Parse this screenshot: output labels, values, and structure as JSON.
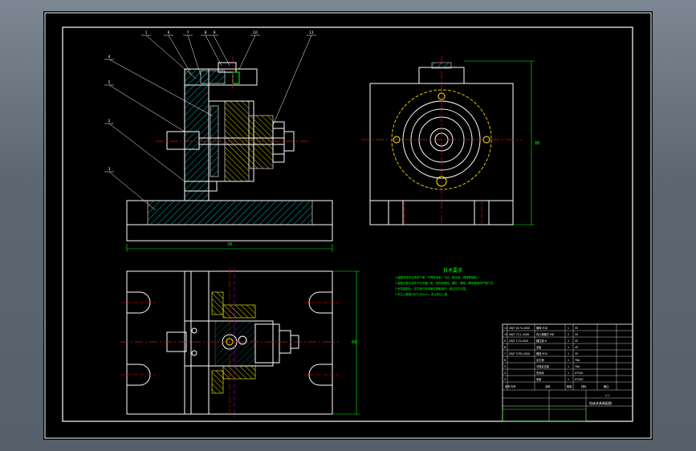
{
  "drawing": {
    "callouts": [
      "1",
      "6",
      "7",
      "8",
      "9",
      "10",
      "11",
      "4",
      "5",
      "2",
      "3"
    ],
    "dimension_left_width": "38",
    "dimension_right_height": "88",
    "dimension_bottom_height": "68"
  },
  "tech_requirements": {
    "title": "技术要求",
    "lines": [
      "1.装配前零件应清洗干净，不得有毛刺、飞边、氧化皮、锈蚀等缺陷。",
      "2.装配过程中零件不允许磕、碰、划伤和锈蚀，螺钉、螺栓、螺母紧固时严禁打击。",
      "3.夹具装配后，定位面与夹紧面应接触良好，保证定位可靠。",
      "4.未注公差按GB/T1804-m，未注形位公差。"
    ]
  },
  "title_block": {
    "col_headers": [
      "序号",
      "代号",
      "名称",
      "数量",
      "材料",
      "备注"
    ],
    "parts": [
      [
        "11",
        "GB/T 6170-2000",
        "螺母 M16",
        "1",
        "35",
        ""
      ],
      [
        "10",
        "GB/T 70.1-2008",
        "内六角螺钉 M8",
        "2",
        "35",
        ""
      ],
      [
        "9",
        "GB/T 119-2000",
        "圆柱销 6",
        "2",
        "35",
        ""
      ],
      [
        "8",
        "",
        "压板",
        "1",
        "45",
        ""
      ],
      [
        "7",
        "GB/T 5783-2000",
        "螺栓 M10",
        "1",
        "35",
        ""
      ],
      [
        "6",
        "",
        "定位销",
        "1",
        "T8A",
        ""
      ],
      [
        "5",
        "",
        "可换定位套",
        "1",
        "T8A",
        ""
      ],
      [
        "4",
        "",
        "夹具体",
        "1",
        "HT200",
        ""
      ],
      [
        "3",
        "",
        "底座",
        "1",
        "HT200",
        ""
      ]
    ],
    "drawing_name": "钻床夹具装配图",
    "scale": "1:1"
  },
  "colors": {
    "background": "#000000",
    "outline": "#ffffff",
    "centerline": "#ff0000",
    "hatch": "#00c8c8",
    "bushing": "#ffff00",
    "dimension": "#00ff00",
    "annotation_text": "#00ff00"
  }
}
